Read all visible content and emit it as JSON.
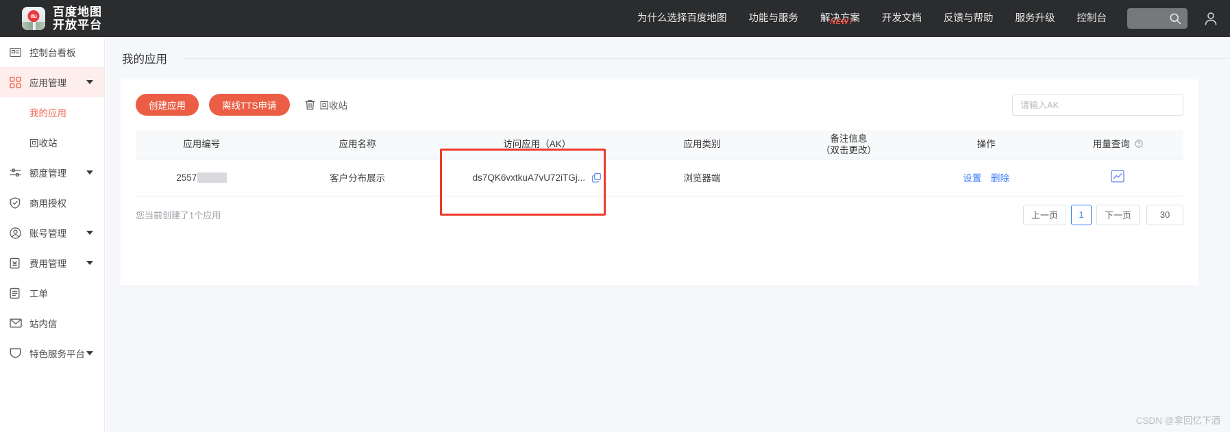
{
  "brand": {
    "logo_line1": "百度地图",
    "logo_line2": "开放平台",
    "logo_pin_text": "du"
  },
  "topnav": {
    "items": [
      {
        "label": "为什么选择百度地图",
        "badge": ""
      },
      {
        "label": "功能与服务",
        "badge": ""
      },
      {
        "label": "解决方案",
        "badge": "NEW！"
      },
      {
        "label": "开发文档",
        "badge": ""
      },
      {
        "label": "反馈与帮助",
        "badge": ""
      },
      {
        "label": "服务升级",
        "badge": ""
      },
      {
        "label": "控制台",
        "badge": ""
      }
    ],
    "search_placeholder": "",
    "badge_color": "#f04a3a"
  },
  "sidebar": {
    "items": [
      {
        "label": "控制台看板",
        "icon": "dashboard-icon",
        "has_caret": false,
        "active": false
      },
      {
        "label": "应用管理",
        "icon": "apps-grid-icon",
        "has_caret": true,
        "active": true
      },
      {
        "label": "额度管理",
        "icon": "sliders-icon",
        "has_caret": true,
        "active": false
      },
      {
        "label": "商用授权",
        "icon": "shield-check-icon",
        "has_caret": false,
        "active": false
      },
      {
        "label": "账号管理",
        "icon": "user-circle-icon",
        "has_caret": true,
        "active": false
      },
      {
        "label": "费用管理",
        "icon": "yuan-doc-icon",
        "has_caret": true,
        "active": false
      },
      {
        "label": "工单",
        "icon": "clipboard-icon",
        "has_caret": false,
        "active": false
      },
      {
        "label": "站内信",
        "icon": "envelope-icon",
        "has_caret": false,
        "active": false
      },
      {
        "label": "特色服务平台",
        "icon": "badge-shield-icon",
        "has_caret": true,
        "active": false
      }
    ],
    "sub_items": [
      {
        "label": "我的应用",
        "current": true
      },
      {
        "label": "回收站",
        "current": false
      }
    ],
    "active_bg": "#fdeeeb",
    "active_text": "#f0624d"
  },
  "page": {
    "title": "我的应用"
  },
  "toolbar": {
    "create_app_label": "创建应用",
    "offline_tts_label": "离线TTS申请",
    "recycle_bin_label": "回收站",
    "recycle_bin_icon": "trash-icon",
    "search_placeholder": "请输入AK",
    "search_value": "",
    "primary_color": "#eb5e45"
  },
  "table": {
    "columns": [
      {
        "key": "app_id",
        "label": "应用编号",
        "sublabel": ""
      },
      {
        "key": "app_name",
        "label": "应用名称",
        "sublabel": ""
      },
      {
        "key": "ak",
        "label": "访问应用（AK）",
        "sublabel": ""
      },
      {
        "key": "app_type",
        "label": "应用类别",
        "sublabel": ""
      },
      {
        "key": "remark",
        "label": "备注信息",
        "sublabel": "（双击更改）"
      },
      {
        "key": "actions",
        "label": "操作",
        "sublabel": ""
      },
      {
        "key": "usage",
        "label": "用量查询",
        "sublabel": ""
      }
    ],
    "rows": [
      {
        "app_id": "2557",
        "app_id_redacted": true,
        "app_name": "客户分布展示",
        "ak": "ds7QK6vxtkuA7vU72iTGj...",
        "ak_copy_icon": "copy-icon",
        "app_type": "浏览器端",
        "remark": "",
        "actions": [
          {
            "label": "设置"
          },
          {
            "label": "删除"
          }
        ],
        "usage_icon": "chart-line-icon"
      }
    ],
    "highlight_color": "#f0392b",
    "link_color": "#3d7eff"
  },
  "footer": {
    "summary": "您当前创建了1个应用",
    "pager": {
      "prev_label": "上一页",
      "current_page": "1",
      "next_label": "下一页",
      "page_size": "30"
    }
  },
  "watermark": {
    "text": "CSDN @拿回忆下酒"
  }
}
